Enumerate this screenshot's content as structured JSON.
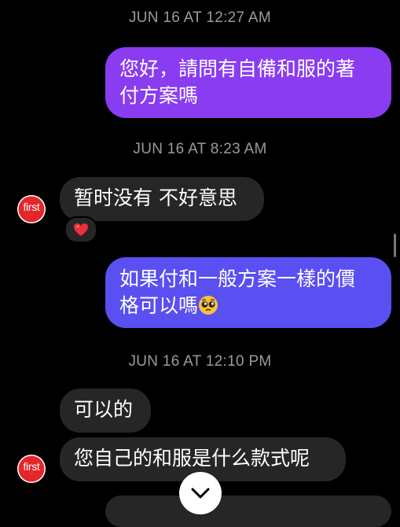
{
  "conversation": {
    "messages": [
      {
        "type": "timestamp",
        "text": "JUN 16 AT 12:27 AM"
      },
      {
        "type": "outgoing",
        "line1": "您好，請問有自備和服的著",
        "line2": "付方案嗎"
      },
      {
        "type": "timestamp",
        "text": "JUN 16 AT 8:23 AM"
      },
      {
        "type": "incoming",
        "text": "暂时没有 不好意思",
        "reaction": "heart-emoji"
      },
      {
        "type": "outgoing",
        "line1": "如果付和一般方案一樣的價",
        "line2": "格可以嗎",
        "emoji": "pleading-face-emoji"
      },
      {
        "type": "timestamp",
        "text": "JUN 16 AT 12:10 PM"
      },
      {
        "type": "incoming",
        "text": "可以的"
      },
      {
        "type": "incoming",
        "text": "您自己的和服是什么款式呢"
      }
    ]
  },
  "sender": {
    "avatar_text": "first",
    "avatar_color": "#e4262b"
  },
  "colors": {
    "background": "#000000",
    "outgoing_top": "#8a3cf0",
    "outgoing_bottom": "#5a4ff0",
    "incoming_bubble": "#262626",
    "timestamp_text": "#9a9a9a"
  },
  "controls": {
    "scroll_down_icon": "chevron-down-icon"
  }
}
